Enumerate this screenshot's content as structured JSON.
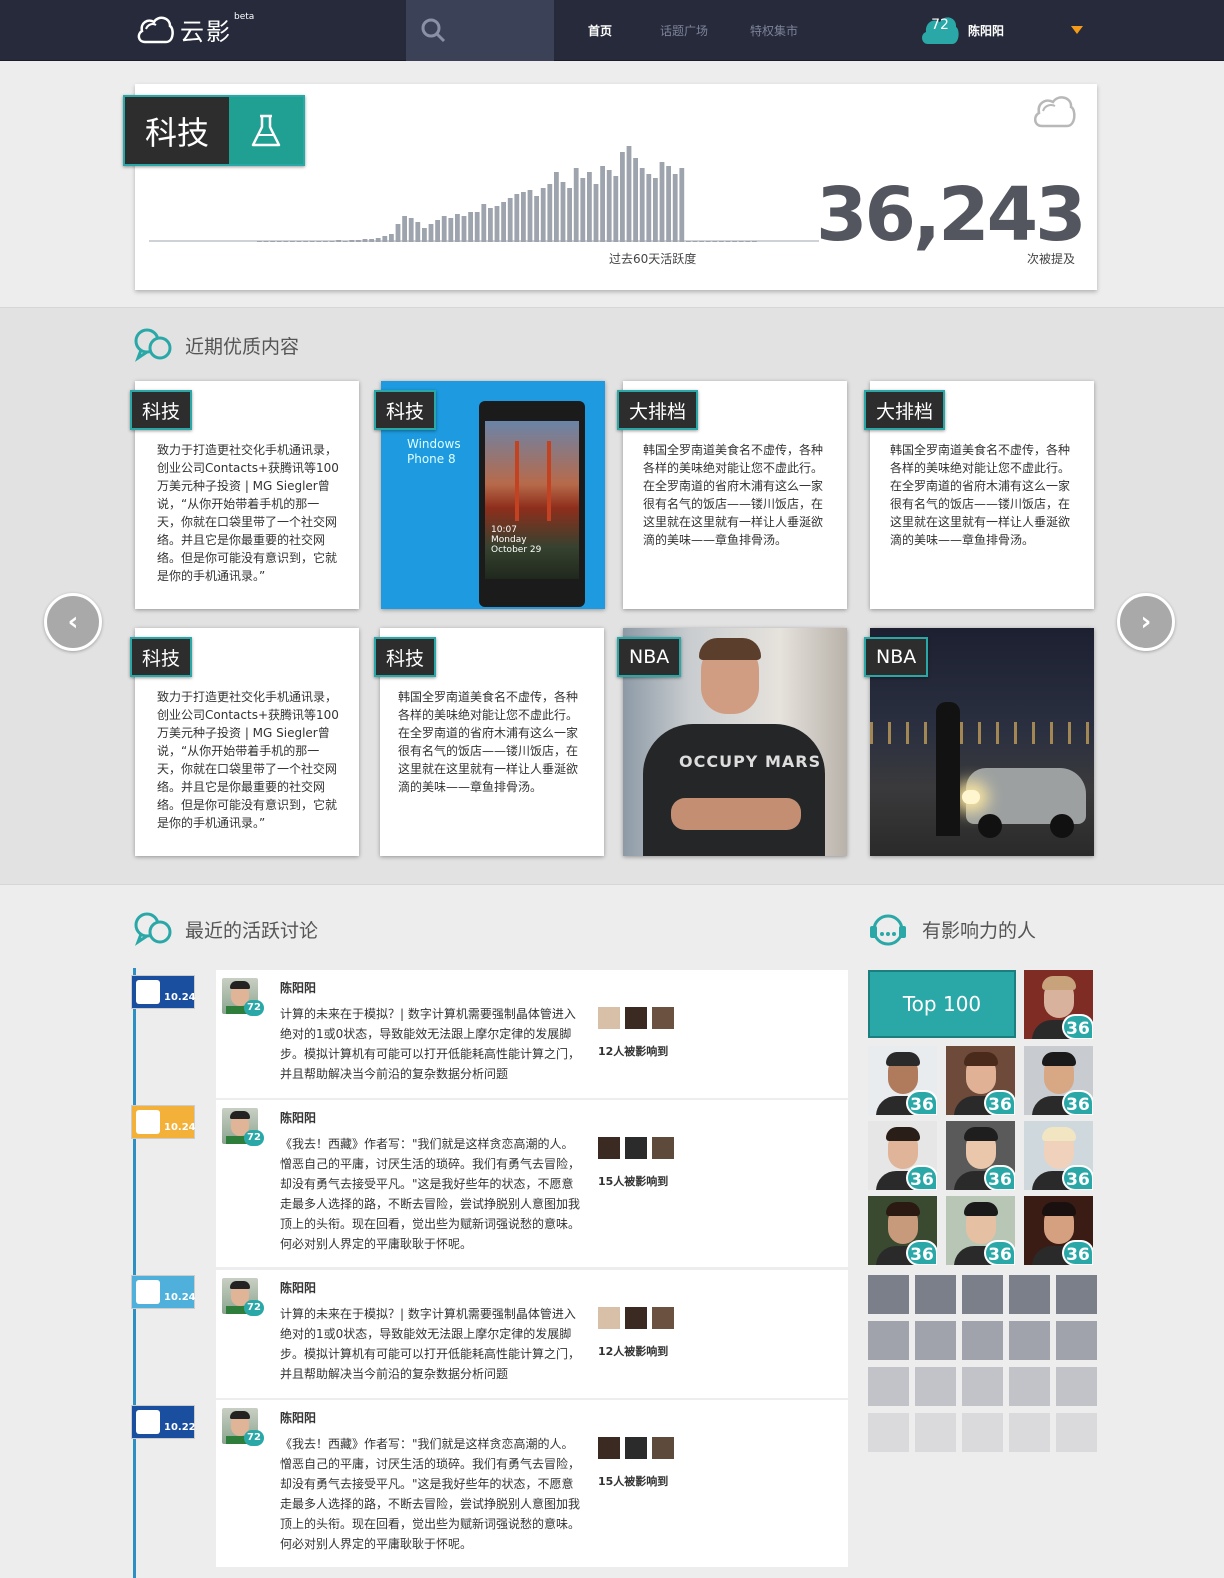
{
  "header": {
    "logo_text": "云影",
    "beta": "beta",
    "nav": [
      "首页",
      "话题广场",
      "特权集市"
    ],
    "user_score": "72",
    "user_name": "陈阳阳"
  },
  "stats": {
    "category": "科技",
    "activity_label": "过去60天活跃度",
    "mentions_count": "36,243",
    "mentions_label": "次被提及",
    "activity_series": [
      1,
      1,
      1,
      1,
      1,
      1,
      1,
      1,
      1,
      1,
      1,
      1,
      2,
      1,
      2,
      2,
      3,
      3,
      4,
      6,
      8,
      18,
      26,
      24,
      20,
      14,
      18,
      22,
      26,
      24,
      28,
      26,
      30,
      30,
      38,
      34,
      36,
      40,
      44,
      48,
      50,
      52,
      46,
      54,
      58,
      70,
      60,
      54,
      74,
      64,
      70,
      58,
      76,
      72,
      66,
      90,
      96,
      84,
      74,
      68,
      64,
      80,
      76,
      68,
      74,
      1,
      1,
      1,
      1,
      1,
      1,
      1,
      1,
      1,
      1,
      1
    ],
    "bar_color": "#9ea4ad",
    "accent": "#2aa8a8"
  },
  "quality": {
    "title": "近期优质内容",
    "cards": [
      {
        "tag": "科技",
        "text": "致力于打造更社交化手机通讯录，创业公司Contacts+获腾讯等100万美元种子投资 | MG Siegler曾说，“从你开始带着手机的那一天，你就在口袋里带了一个社交网络。并且它是你最重要的社交网络。但是你可能没有意识到，它就是你的手机通讯录。”"
      },
      {
        "tag": "科技",
        "phone_brand": "Windows Phone 8",
        "phone_time": "10:07",
        "phone_day": "Monday",
        "phone_date": "October 29"
      },
      {
        "tag": "大排档",
        "text": "韩国全罗南道美食名不虚传，各种各样的美味绝对能让您不虚此行。在全罗南道的省府木浦有这么一家很有名气的饭店——镂川饭店，在这里就在这里就有一样让人垂涎欲滴的美味——章鱼排骨汤。"
      },
      {
        "tag": "大排档",
        "text": "韩国全罗南道美食名不虚传，各种各样的美味绝对能让您不虚此行。在全罗南道的省府木浦有这么一家很有名气的饭店——镂川饭店，在这里就在这里就有一样让人垂涎欲滴的美味——章鱼排骨汤。"
      },
      {
        "tag": "科技",
        "text": "致力于打造更社交化手机通讯录，创业公司Contacts+获腾讯等100万美元种子投资 | MG Siegler曾说，“从你开始带着手机的那一天，你就在口袋里带了一个社交网络。并且它是你最重要的社交网络。但是你可能没有意识到，它就是你的手机通讯录。”"
      },
      {
        "tag": "科技",
        "text": "韩国全罗南道美食名不虚传，各种各样的美味绝对能让您不虚此行。在全罗南道的省府木浦有这么一家很有名气的饭店——镂川饭店，在这里就在这里就有一样让人垂涎欲滴的美味——章鱼排骨汤。"
      },
      {
        "tag": "NBA",
        "shirt_text": "OCCUPY MARS"
      },
      {
        "tag": "NBA"
      }
    ],
    "prev": "‹",
    "next": "›"
  },
  "discussions": {
    "title": "最近的活跃讨论",
    "items": [
      {
        "date": "10.24",
        "source_color": "#1a4fa0",
        "name": "陈阳阳",
        "score": "72",
        "text": "计算的未来在于模拟？| 数字计算机需要强制晶体管进入绝对的1或0状态，导致能效无法跟上摩尔定律的发展脚步。模拟计算机有可能可以打开低能耗高性能计算之门，并且帮助解决当今前沿的复杂数据分析问题",
        "influenced": "12人被影响到"
      },
      {
        "date": "10.24",
        "source_color": "#f3b13a",
        "name": "陈阳阳",
        "score": "72",
        "text": "《我去！西藏》作者写：\"我们就是这样贪恋高潮的人。憎恶自己的平庸，讨厌生活的琐碎。我们有勇气去冒险，却没有勇气去接受平凡。\"这是我好些年的状态，不愿意走最多人选择的路，不断去冒险，尝试挣脱别人意图加我顶上的头衔。现在回看，觉出些为赋新词强说愁的意味。何必对别人界定的平庸耿耿于怀呢。",
        "influenced": "15人被影响到"
      },
      {
        "date": "10.24",
        "source_color": "#4fb0db",
        "name": "陈阳阳",
        "score": "72",
        "text": "计算的未来在于模拟？| 数字计算机需要强制晶体管进入绝对的1或0状态，导致能效无法跟上摩尔定律的发展脚步。模拟计算机有可能可以打开低能耗高性能计算之门，并且帮助解决当今前沿的复杂数据分析问题",
        "influenced": "12人被影响到"
      },
      {
        "date": "10.22",
        "source_color": "#1a4fa0",
        "name": "陈阳阳",
        "score": "72",
        "text": "《我去！西藏》作者写：\"我们就是这样贪恋高潮的人。憎恶自己的平庸，讨厌生活的琐碎。我们有勇气去冒险，却没有勇气去接受平凡。\"这是我好些年的状态，不愿意走最多人选择的路，不断去冒险，尝试挣脱别人意图加我顶上的头衔。现在回看，觉出些为赋新词强说愁的意味。何必对别人界定的平庸耿耿于怀呢。",
        "influenced": "15人被影响到"
      }
    ]
  },
  "influencers": {
    "title": "有影响力的人",
    "top_button": "Top 100",
    "people": [
      {
        "score": "36"
      },
      {
        "score": "36"
      },
      {
        "score": "36"
      },
      {
        "score": "36"
      },
      {
        "score": "36"
      },
      {
        "score": "36"
      },
      {
        "score": "36"
      },
      {
        "score": "36"
      },
      {
        "score": "36"
      },
      {
        "score": "36"
      }
    ]
  }
}
